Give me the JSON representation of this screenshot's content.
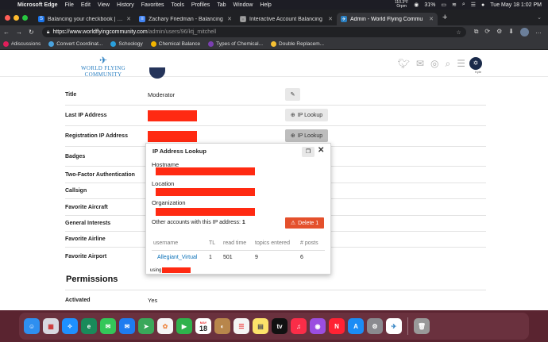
{
  "menubar": {
    "app_name": "Microsoft Edge",
    "items": [
      "File",
      "Edit",
      "View",
      "History",
      "Favorites",
      "Tools",
      "Profiles",
      "Tab",
      "Window",
      "Help"
    ],
    "weather_temp": "110.3°F",
    "weather_city": "Orpm",
    "battery": "31%",
    "datetime": "Tue May 18  1:02 PM"
  },
  "tabs": [
    {
      "title": "Balancing your checkbook | Sc",
      "color": "#1a73e8",
      "icon": "S"
    },
    {
      "title": "Zachary Friedman - Balancing",
      "color": "#4285f4",
      "icon": "≡"
    },
    {
      "title": "Interactive Account Balancing",
      "color": "#888888",
      "icon": "▢"
    },
    {
      "title": "Admin - World Flying Commu",
      "color": "#2a7fc1",
      "icon": "✈"
    }
  ],
  "address": {
    "host": "https://www.worldflyingcommunity.com",
    "path": "/admin/users/96/ktj_mitchell"
  },
  "bookmarks": [
    {
      "label": "#discussions",
      "color": "#e01e5a"
    },
    {
      "label": "Convert Coordinat...",
      "color": "#4aa3df"
    },
    {
      "label": "Schoology",
      "color": "#2aa0dc"
    },
    {
      "label": "Chemical Balance",
      "color": "#f2b400"
    },
    {
      "label": "Types of Chemical...",
      "color": "#7a3fb0"
    },
    {
      "label": "Double Replacem...",
      "color": "#f5c033"
    }
  ],
  "site": {
    "logo_text": "WORLD FLYING COMMUNITY",
    "avatar_label": "Kyle"
  },
  "rows": [
    {
      "label": "Title",
      "value": "Moderator"
    },
    {
      "label": "Last IP Address",
      "value": ""
    },
    {
      "label": "Registration IP Address",
      "value": ""
    },
    {
      "label": "Badges",
      "value": ""
    },
    {
      "label": "Two-Factor Authentication",
      "value": ""
    },
    {
      "label": "Callsign",
      "value": ""
    },
    {
      "label": "Favorite Aircraft",
      "value": ""
    },
    {
      "label": "General Interests",
      "value": ""
    },
    {
      "label": "Favorite Airline",
      "value": ""
    },
    {
      "label": "Favorite Airport",
      "value": ""
    }
  ],
  "buttons": {
    "ip_lookup": "IP Lookup"
  },
  "permissions": {
    "title": "Permissions",
    "activated_label": "Activated",
    "activated_value": "Yes"
  },
  "popup": {
    "title": "IP Address Lookup",
    "hostname_label": "Hostname",
    "location_label": "Location",
    "organization_label": "Organization",
    "other_accounts_label": "Other accounts with this IP address:",
    "other_accounts_count": "1",
    "delete_label": "Delete 1",
    "columns": [
      "username",
      "TL",
      "read time",
      "topics entered",
      "# posts"
    ],
    "row": {
      "username": "Allegiant_Virtual",
      "tl": "1",
      "read_time": "501",
      "topics": "9",
      "posts": "6"
    },
    "using_label": "using"
  },
  "dock": {
    "calendar_month": "MAY",
    "calendar_day": "18"
  },
  "colors": {
    "redaction": "#ff2a12",
    "delete": "#e4502c",
    "link": "#0a70b8",
    "brand": "#2a7fc1"
  }
}
